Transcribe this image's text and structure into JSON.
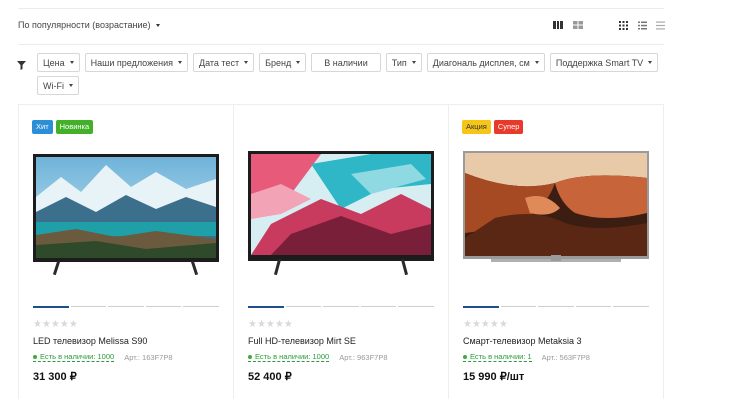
{
  "sort": {
    "label": "По популярности (возрастание)"
  },
  "view_icons": [
    "catalog-view-large-icon",
    "catalog-view-medium-icon",
    "grid-view-icon",
    "list-view-icon",
    "table-view-icon"
  ],
  "filters": [
    "Цена",
    "Наши предложения",
    "Дата тест",
    "Бренд",
    "В наличии",
    "Тип",
    "Диагональ дисплея, см",
    "Поддержка Smart TV",
    "Wi-Fi"
  ],
  "colors": {
    "hit": "#2d8ed8",
    "new": "#43b02a",
    "promo": "#f5c518",
    "super": "#e8392a",
    "in_stock": "#2a9a3b"
  },
  "products": [
    {
      "badges": [
        {
          "text": "Хит",
          "color": "#2d8ed8"
        },
        {
          "text": "Новинка",
          "color": "#43b02a"
        }
      ],
      "name": "LED телевизор Melissa S90",
      "stock": "Есть в наличии: 1000",
      "article": "Арт.: 163F7P8",
      "price": "31 300 ₽",
      "rating": "★★★★★"
    },
    {
      "badges": [],
      "name": "Full HD-телевизор Mirt SE",
      "stock": "Есть в наличии: 1000",
      "article": "Арт.: 963F7P8",
      "price": "52 400 ₽",
      "rating": "★★★★★"
    },
    {
      "badges": [
        {
          "text": "Акция",
          "color": "#f5c518"
        },
        {
          "text": "Супер",
          "color": "#e8392a"
        }
      ],
      "name": "Смарт-телевизор Metaksia 3",
      "stock": "Есть в наличии: 1",
      "article": "Арт.: 563F7P8",
      "price": "15 990 ₽/шт",
      "rating": "★★★★★"
    }
  ]
}
